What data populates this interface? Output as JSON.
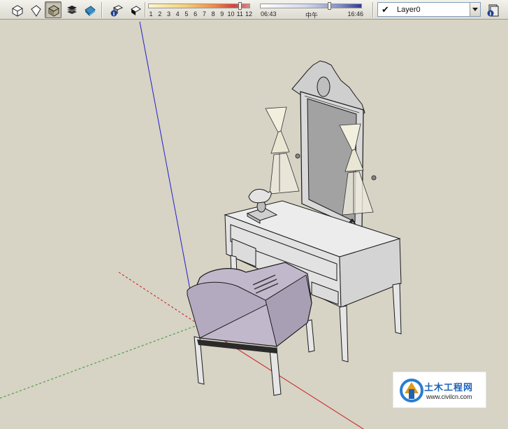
{
  "toolbar": {
    "view_buttons": [
      {
        "name": "hidden-line-style",
        "icon": "cube-outline-icon",
        "active": false
      },
      {
        "name": "wireframe-style",
        "icon": "cube-wire-icon",
        "active": false
      },
      {
        "name": "shaded-style",
        "icon": "cube-shaded-icon",
        "active": true
      },
      {
        "name": "monochrome-style",
        "icon": "layered-boxes-icon",
        "active": false
      },
      {
        "name": "shaded-with-textures-style",
        "icon": "cube-textured-icon",
        "active": false
      }
    ],
    "shadow_buttons": [
      {
        "name": "shadow-settings",
        "icon": "shadow-info-icon"
      },
      {
        "name": "display-shadows",
        "icon": "shadow-toggle-icon"
      }
    ],
    "month_slider": {
      "ticks": [
        "1",
        "2",
        "3",
        "4",
        "5",
        "6",
        "7",
        "8",
        "9",
        "10",
        "11",
        "12"
      ],
      "value": 11
    },
    "time_slider": {
      "start": "06:43",
      "noon": "中午",
      "end": "16:46",
      "value_fraction": 0.68
    },
    "layer": {
      "checked_symbol": "✔",
      "name": "Layer0"
    }
  },
  "colors": {
    "viewport_bg": "#d7d3c5",
    "blue_axis": "#2020c8",
    "red_axis": "#c81818",
    "green_axis": "#2c9a2c",
    "chair_fabric": "#c2b8cc",
    "desk": "#e4e4e4",
    "outline": "#1a1a1a"
  },
  "watermark": {
    "title": "土木工程网",
    "url": "www.civilcn.com"
  }
}
